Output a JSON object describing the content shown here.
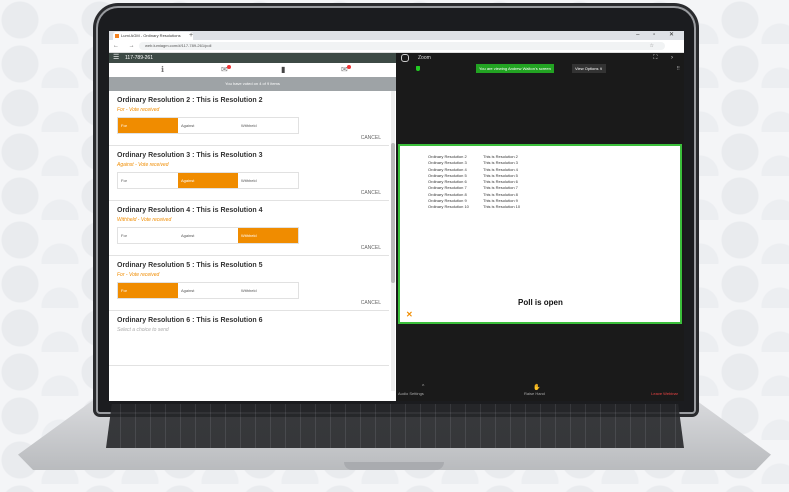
{
  "browser": {
    "tab_title": "Lumi AGM - Ordinary Resolutions",
    "new_tab": "+",
    "window_controls": "– ▫ ✕",
    "nav_icons": "← → C",
    "url": "web.lumiagm.com/#/117-789-261/poll"
  },
  "app": {
    "meeting_id": "117-789-261",
    "banner": "You have voted on 4 of 9 items"
  },
  "resolutions": [
    {
      "title": "Ordinary Resolution 2 : This is Resolution 2",
      "status": "For - Vote received",
      "options": [
        "For",
        "Against",
        "Withheld"
      ],
      "selected": 0,
      "cancel": "CANCEL"
    },
    {
      "title": "Ordinary Resolution 3 : This is Resolution 3",
      "status": "Against - Vote received",
      "options": [
        "For",
        "Against",
        "Withheld"
      ],
      "selected": 1,
      "cancel": "CANCEL"
    },
    {
      "title": "Ordinary Resolution 4 : This is Resolution 4",
      "status": "Withheld - Vote received",
      "options": [
        "For",
        "Against",
        "Withheld"
      ],
      "selected": 2,
      "cancel": "CANCEL"
    },
    {
      "title": "Ordinary Resolution 5 : This is Resolution 5",
      "status": "For - Vote received",
      "options": [
        "For",
        "Against",
        "Withheld"
      ],
      "selected": 0,
      "cancel": "CANCEL"
    },
    {
      "title": "Ordinary Resolution 6 : This is Resolution 6",
      "status": "Select a choice to send",
      "options": [],
      "selected": -1,
      "cancel": ""
    }
  ],
  "zoom": {
    "title": "Zoom",
    "viewing": "You are viewing Andrew Walton's screen",
    "view_options": "View Options ∨",
    "slide_rows": [
      [
        "Ordinary Resolution 2",
        "This is Resolution 2"
      ],
      [
        "Ordinary Resolution 3",
        "This is Resolution 3"
      ],
      [
        "Ordinary Resolution 4",
        "This is Resolution 4"
      ],
      [
        "Ordinary Resolution 5",
        "This is Resolution 5"
      ],
      [
        "Ordinary Resolution 6",
        "This is Resolution 6"
      ],
      [
        "Ordinary Resolution 7",
        "This is Resolution 7"
      ],
      [
        "Ordinary Resolution 8",
        "This is Resolution 8"
      ],
      [
        "Ordinary Resolution 9",
        "This is Resolution 9"
      ],
      [
        "Ordinary Resolution 10",
        "This is Resolution 10"
      ]
    ],
    "poll_status": "Poll is open",
    "brand": "LUMI",
    "bottom_left": "Audio Settings",
    "bottom_center": "Raise Hand",
    "bottom_right": "Leave Webinar"
  },
  "colors": {
    "accent": "#f08c00",
    "topbar": "#3d4a45",
    "zoom_green": "#3bbf3b"
  }
}
